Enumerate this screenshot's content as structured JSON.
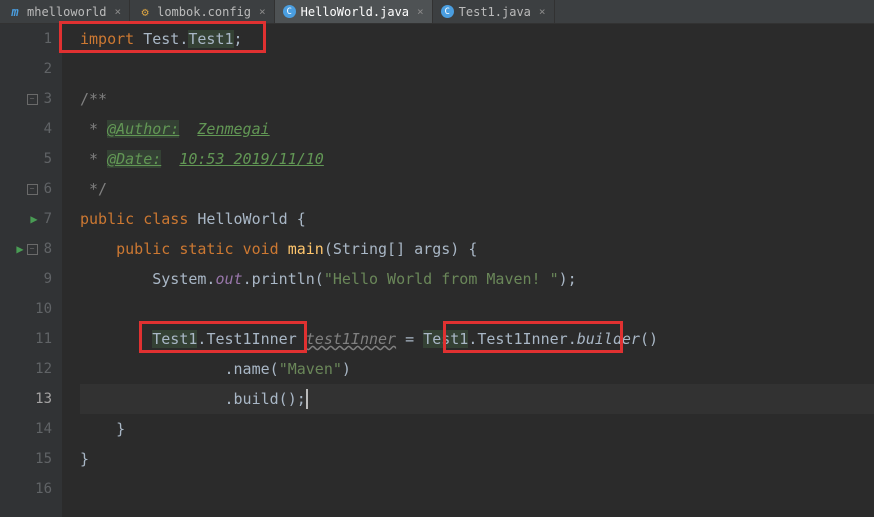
{
  "tabs": [
    {
      "label": "mhelloworld",
      "icon": "m",
      "iconColor": "#4a9ee0",
      "active": false
    },
    {
      "label": "lombok.config",
      "icon": "gear",
      "iconColor": "#d9a343",
      "active": false
    },
    {
      "label": "HelloWorld.java",
      "icon": "c",
      "iconColor": "#4a9ee0",
      "active": true
    },
    {
      "label": "Test1.java",
      "icon": "c",
      "iconColor": "#4a9ee0",
      "active": false
    }
  ],
  "lines": {
    "1": {
      "kw": "import",
      "pkg": "Test",
      "cls": "Test1"
    },
    "3": {
      "open": "/**"
    },
    "4": {
      "tag": "@Author:",
      "val": "Zenmegai"
    },
    "5": {
      "tag": "@Date:",
      "val": "10:53 2019/11/10"
    },
    "6": {
      "close": "*/"
    },
    "7": {
      "kw1": "public",
      "kw2": "class",
      "name": "HelloWorld",
      "brace": "{"
    },
    "8": {
      "kw1": "public",
      "kw2": "static",
      "kw3": "void",
      "method": "main",
      "params": "(String[] args) {"
    },
    "9": {
      "sys": "System.",
      "out": "out",
      "dot": ".println(",
      "str": "\"Hello World from Maven! \"",
      "end": ");"
    },
    "11": {
      "cls1": "Test1",
      "dot1": ".",
      "inner1": "Test1Inner",
      "var": "test1Inner",
      "eq": " = ",
      "cls2": "Test1",
      "dot2": ".",
      "inner2": "Test1Inner",
      "dot3": ".",
      "builder": "builder",
      "end": "()"
    },
    "12": {
      "dot": ".name(",
      "str": "\"Maven\"",
      "end": ")"
    },
    "13": {
      "dot": ".build()",
      "semi": ";"
    },
    "14": {
      "brace": "}"
    },
    "15": {
      "brace": "}"
    }
  },
  "gutterCount": 16,
  "currentLine": 13
}
